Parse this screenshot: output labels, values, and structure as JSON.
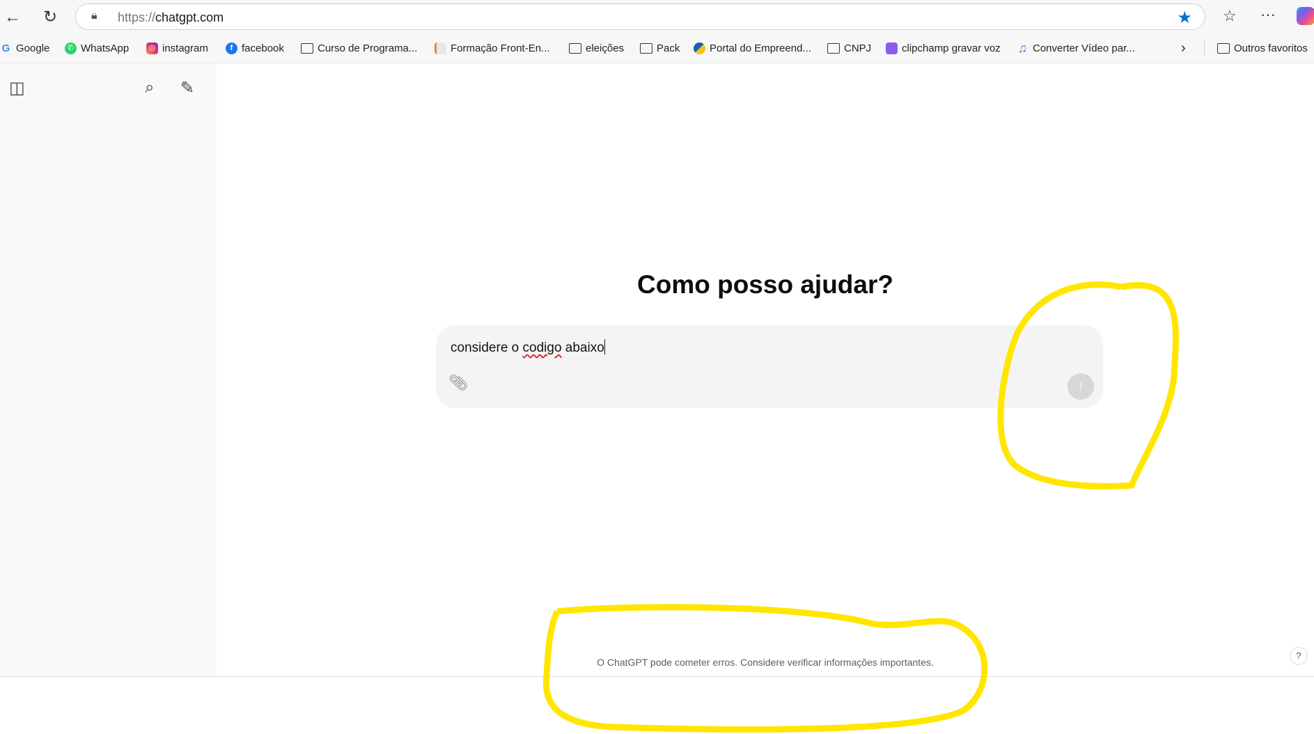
{
  "browser": {
    "url_scheme": "https://",
    "url_host": "chatgpt.com",
    "icons": [
      "back-icon",
      "refresh-icon",
      "lock-icon",
      "favorite-star-icon",
      "favorites-icon",
      "more-icon",
      "copilot-icon"
    ],
    "accent": "#0b6fd6"
  },
  "bookmarks": [
    {
      "label": "Google"
    },
    {
      "label": "WhatsApp"
    },
    {
      "label": "instagram"
    },
    {
      "label": "facebook"
    },
    {
      "label": "Curso de Programa..."
    },
    {
      "label": "Formação Front-En..."
    },
    {
      "label": "eleições"
    },
    {
      "label": "Pack"
    },
    {
      "label": "Portal do Empreend..."
    },
    {
      "label": "CNPJ"
    },
    {
      "label": "clipchamp gravar voz"
    },
    {
      "label": "Converter Vídeo par..."
    }
  ],
  "other_favorites": "Outros favoritos",
  "main": {
    "title": "Como posso ajudar?",
    "input_before": "considere o ",
    "input_misspelled": "codigo",
    "input_after": " abaixo",
    "footer": "O ChatGPT pode cometer erros. Considere verificar informações importantes.",
    "help": "?"
  },
  "annotation_color": "#ffe600"
}
